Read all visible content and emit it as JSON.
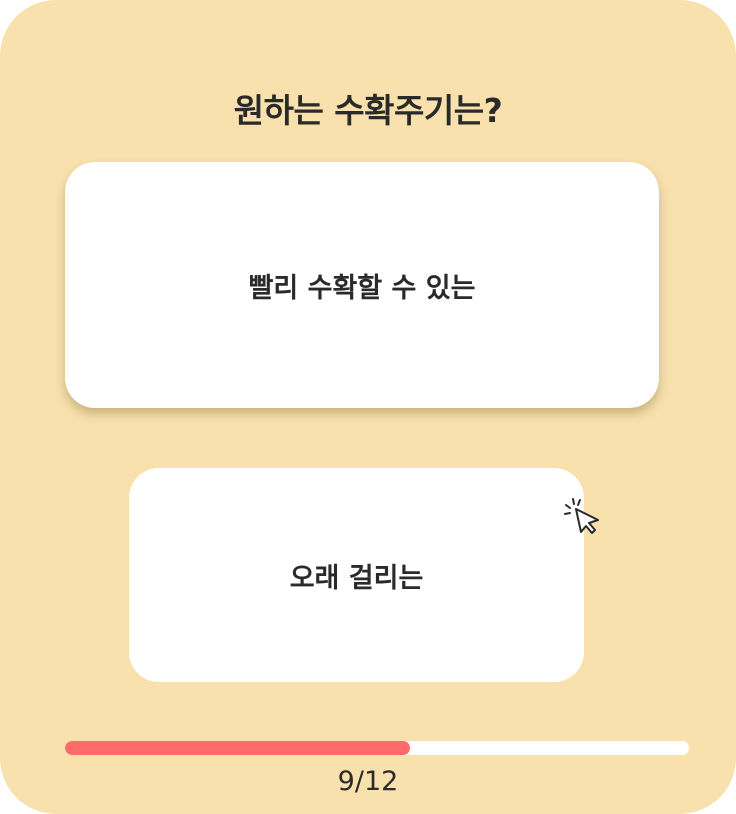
{
  "quiz": {
    "question": "원하는 수확주기는?",
    "options": [
      {
        "label": "빨리 수확할 수 있는"
      },
      {
        "label": "오래 걸리는"
      }
    ],
    "progress": {
      "label": "9/12",
      "fraction": 0.553
    }
  },
  "icons": {
    "pointer": "click-pointer-icon"
  },
  "colors": {
    "background": "#f8e1ad",
    "card": "#ffffff",
    "progress_fill": "#ff6b6b",
    "text": "#2a2a2a"
  }
}
